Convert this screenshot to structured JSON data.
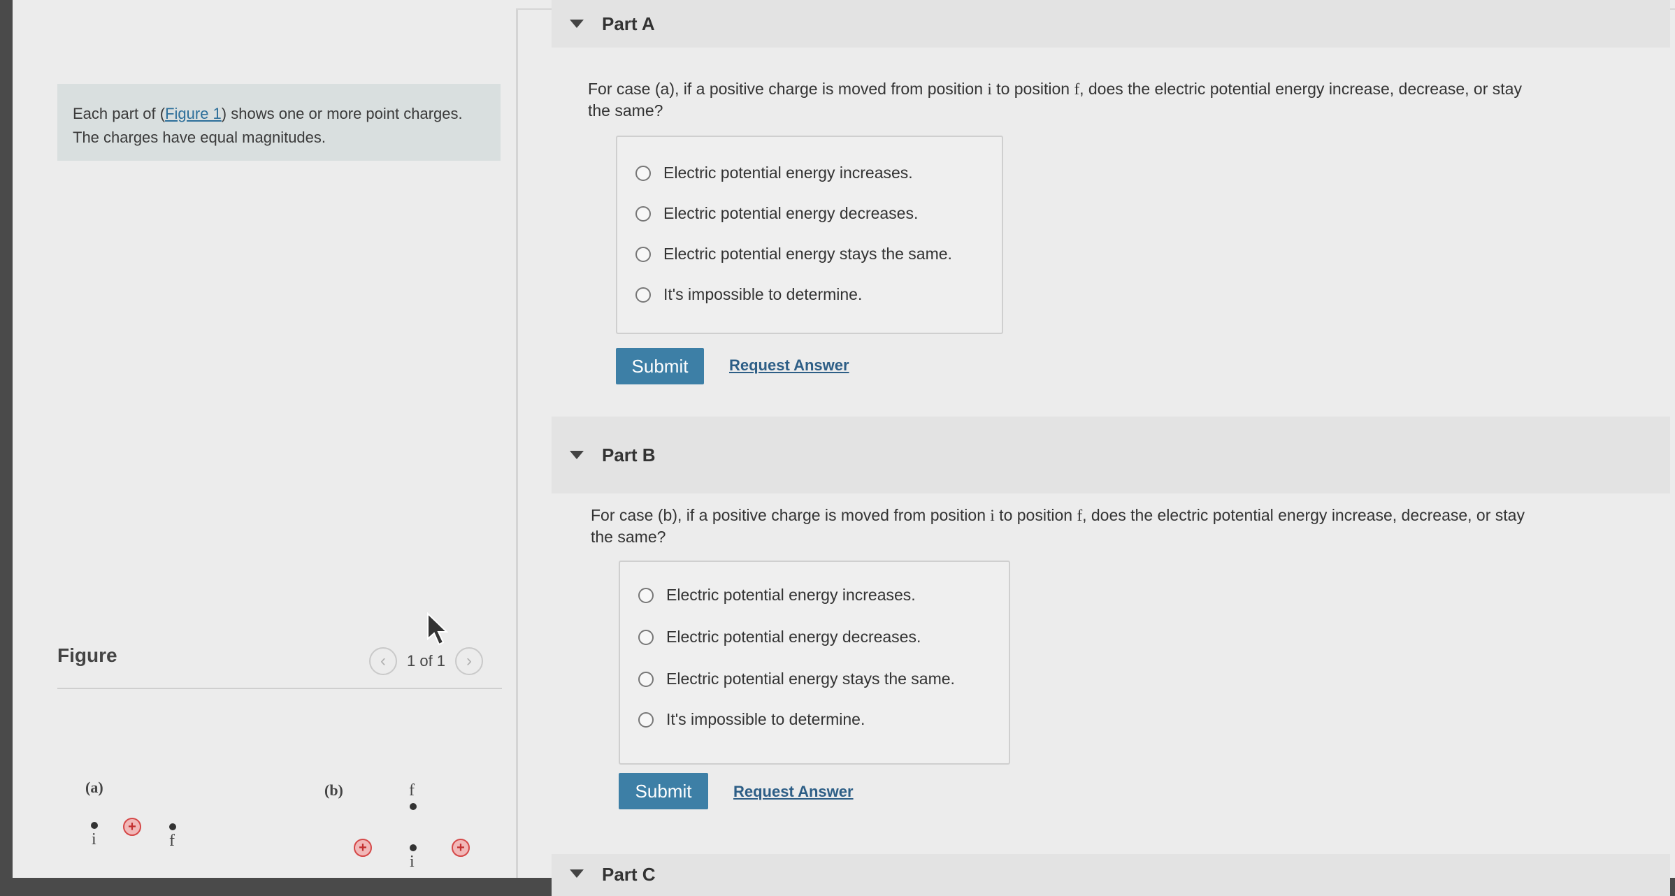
{
  "intro": {
    "text_before": "Each part of (",
    "figure_link": "Figure 1",
    "text_after": ") shows one or more point charges.",
    "line2": "The charges have equal magnitudes."
  },
  "figure": {
    "title": "Figure",
    "pager": "1 of 1",
    "prev_icon": "chevron-left-icon",
    "next_icon": "chevron-right-icon",
    "case_a_label": "(a)",
    "case_b_label": "(b)",
    "pos_i": "i",
    "pos_f": "f",
    "charge_sign": "+",
    "charge_color": "#d54848"
  },
  "partA": {
    "title": "Part A",
    "question_1": "For case (a), if a positive charge is moved from position ",
    "i": "i",
    "question_2": " to position ",
    "f": "f",
    "question_3": ", does the electric potential energy increase, decrease, or stay",
    "question_line2": "the same?",
    "choices": [
      "Electric potential energy increases.",
      "Electric potential energy decreases.",
      "Electric potential energy stays the same.",
      "It's impossible to determine."
    ],
    "submit": "Submit",
    "request": "Request Answer"
  },
  "partB": {
    "title": "Part B",
    "question_1": "For case (b), if a positive charge is moved from position ",
    "i": "i",
    "question_2": " to position ",
    "f": "f",
    "question_3": ", does the electric potential energy increase, decrease, or stay",
    "question_line2": "the same?",
    "choices": [
      "Electric potential energy increases.",
      "Electric potential energy decreases.",
      "Electric potential energy stays the same.",
      "It's impossible to determine."
    ],
    "submit": "Submit",
    "request": "Request Answer"
  },
  "partC": {
    "title": "Part C"
  },
  "colors": {
    "accent": "#3d7fa6",
    "link": "#2d5e86"
  }
}
